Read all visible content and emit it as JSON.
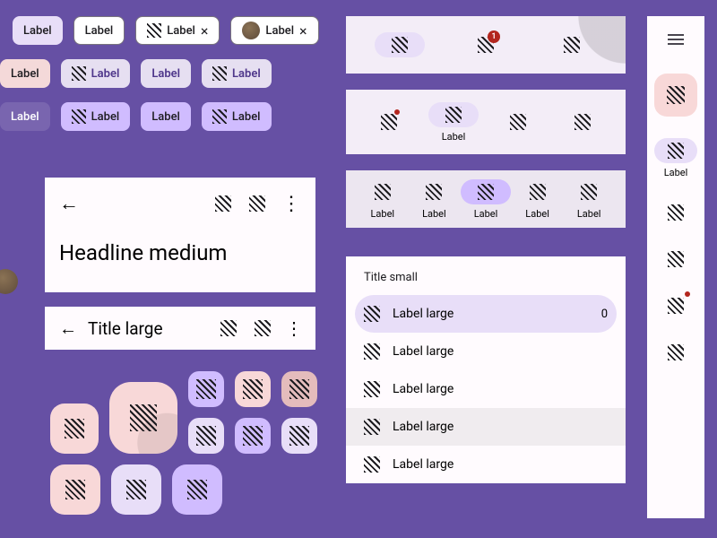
{
  "chips": {
    "row1": [
      {
        "label": "Label",
        "variant": "l"
      },
      {
        "label": "Label",
        "variant": "o"
      },
      {
        "label": "Label",
        "variant": "o",
        "icon": true,
        "close": true
      },
      {
        "label": "Label",
        "variant": "o",
        "avatar": true,
        "close": true
      }
    ],
    "row2": [
      {
        "label": "Label",
        "variant": "p"
      },
      {
        "label": "Label",
        "variant": "lp",
        "icon": true
      },
      {
        "label": "Label",
        "variant": "lp"
      },
      {
        "label": "Label",
        "variant": "lp",
        "icon": true
      }
    ],
    "row3": [
      {
        "label": "Label",
        "variant": "f"
      },
      {
        "label": "Label",
        "variant": "vl",
        "icon": true
      },
      {
        "label": "Label",
        "variant": "vl"
      },
      {
        "label": "Label",
        "variant": "vl",
        "icon": true
      }
    ]
  },
  "appbar1": {
    "headline": "Headline medium"
  },
  "appbar2": {
    "title": "Title large"
  },
  "nav1": {
    "items": [
      {
        "sel": true
      },
      {
        "badge": "1"
      },
      {}
    ]
  },
  "nav2": {
    "items": [
      {
        "dot": true
      },
      {
        "sel": true,
        "label": "Label"
      },
      {},
      {}
    ]
  },
  "nav3": {
    "items": [
      {
        "label": "Label"
      },
      {
        "label": "Label"
      },
      {
        "label": "Label",
        "sel": true
      },
      {
        "label": "Label"
      },
      {
        "label": "Label"
      }
    ]
  },
  "list": {
    "title": "Title small",
    "items": [
      {
        "label": "Label large",
        "sel": true,
        "count": "0"
      },
      {
        "label": "Label large"
      },
      {
        "label": "Label large"
      },
      {
        "label": "Label large",
        "hover": true
      },
      {
        "label": "Label large"
      }
    ]
  },
  "rail": {
    "label": "Label"
  }
}
